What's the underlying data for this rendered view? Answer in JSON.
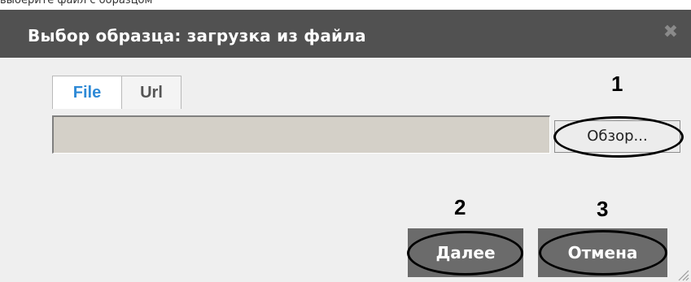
{
  "top_caption": "выберите файл с образцом",
  "dialog": {
    "title": "Выбор образца: загрузка из файла",
    "close_symbol": "✖"
  },
  "tabs": [
    {
      "label": "File",
      "active": true
    },
    {
      "label": "Url",
      "active": false
    }
  ],
  "file_input": {
    "value": ""
  },
  "browse_button": {
    "label": "Обзор..."
  },
  "callouts": {
    "one": "1",
    "two": "2",
    "three": "3"
  },
  "buttons": {
    "next": "Далее",
    "cancel": "Отмена"
  },
  "colors": {
    "titlebar": "#515151",
    "dialog_bg": "#efefef",
    "active_tab_text": "#2f8ad6",
    "action_button": "#6b6b6b"
  }
}
